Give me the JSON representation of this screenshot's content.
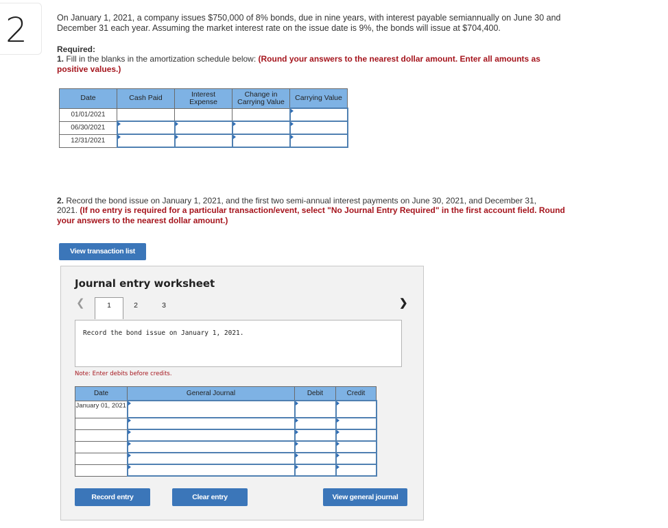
{
  "question_number": "2",
  "intro": {
    "line1": "On January 1, 2021, a company issues $750,000 of 8% bonds, due in nine years, with interest payable semiannually on June 30 and",
    "line2": "December 31 each year. Assuming the market interest rate on the issue date is 9%, the bonds will issue at $704,400."
  },
  "required": {
    "label": "Required:",
    "part1_num": "1.",
    "part1_text": " Fill in the blanks in the amortization schedule below: ",
    "part1_red_a": "(Round your answers to the nearest dollar amount. Enter all amounts as",
    "part1_red_b": "positive values.)"
  },
  "amortization": {
    "headers": [
      "Date",
      "Cash Paid",
      "Interest Expense",
      "Change in Carrying Value",
      "Carrying Value"
    ],
    "header_lines": [
      [
        "Date"
      ],
      [
        "Cash Paid"
      ],
      [
        "Interest",
        "Expense"
      ],
      [
        "Change in",
        "Carrying Value"
      ],
      [
        "Carrying Value"
      ]
    ],
    "rows": [
      {
        "date": "01/01/2021",
        "cash_paid": "",
        "interest_expense": "",
        "change": "",
        "carrying_value": ""
      },
      {
        "date": "06/30/2021",
        "cash_paid": "",
        "interest_expense": "",
        "change": "",
        "carrying_value": ""
      },
      {
        "date": "12/31/2021",
        "cash_paid": "",
        "interest_expense": "",
        "change": "",
        "carrying_value": ""
      }
    ]
  },
  "part2": {
    "num": "2.",
    "text_a": " Record the bond issue on January 1, 2021, and the first two semi-annual interest payments on June 30, 2021, and December 31,",
    "text_b": "2021. ",
    "red_a": "(If no entry is required for a particular transaction/event, select \"No Journal Entry Required\" in the first account field. Round",
    "red_b": "your answers to the nearest dollar amount.)"
  },
  "buttons": {
    "view_transaction_list": "View transaction list",
    "record_entry": "Record entry",
    "clear_entry": "Clear entry",
    "view_general_journal": "View general journal"
  },
  "worksheet": {
    "title": "Journal entry worksheet",
    "tabs": [
      "1",
      "2",
      "3"
    ],
    "active_tab": "1",
    "prev_icon": "chevron-left-icon",
    "next_icon": "chevron-right-icon",
    "description": "Record the bond issue on January 1, 2021.",
    "note": "Note: Enter debits before credits.",
    "journal": {
      "headers": [
        "Date",
        "General Journal",
        "Debit",
        "Credit"
      ],
      "rows": [
        {
          "date": "January 01, 2021",
          "account": "",
          "debit": "",
          "credit": ""
        },
        {
          "date": "",
          "account": "",
          "debit": "",
          "credit": ""
        },
        {
          "date": "",
          "account": "",
          "debit": "",
          "credit": ""
        },
        {
          "date": "",
          "account": "",
          "debit": "",
          "credit": ""
        },
        {
          "date": "",
          "account": "",
          "debit": "",
          "credit": ""
        },
        {
          "date": "",
          "account": "",
          "debit": "",
          "credit": ""
        }
      ]
    }
  },
  "colors": {
    "header_blue": "#7eb2e4",
    "button_blue": "#3b76b9",
    "instruction_red": "#a5151d",
    "panel_bg": "#f2f2f2"
  }
}
